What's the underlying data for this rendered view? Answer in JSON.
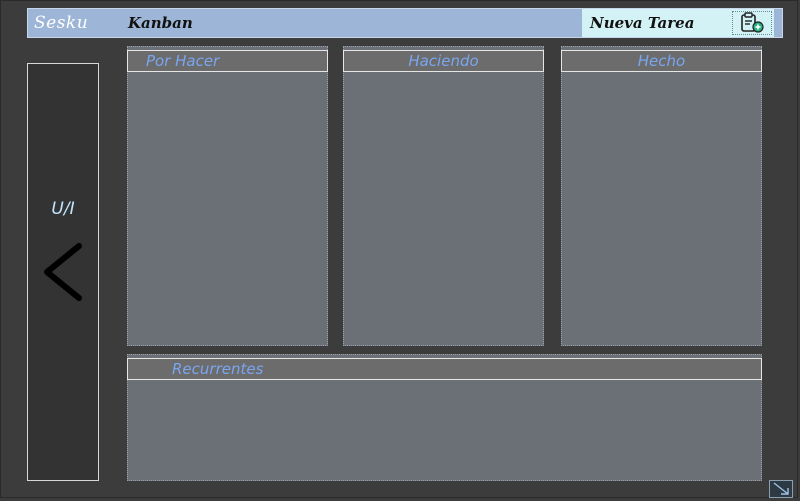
{
  "header": {
    "app_title": "Sesku",
    "view_title": "Kanban",
    "new_task_label": "Nueva Tarea",
    "new_task_icon": "clipboard-add-icon"
  },
  "side_panel": {
    "label": "U/I",
    "collapse_icon": "chevron-left-icon"
  },
  "columns": [
    {
      "label": "Por Hacer"
    },
    {
      "label": "Haciendo"
    },
    {
      "label": "Hecho"
    }
  ],
  "recurrent": {
    "label": "Recurrentes"
  },
  "colors": {
    "header_bg": "#9db5d6",
    "new_task_bg": "#d2f2f6",
    "column_bg": "#6b6f76",
    "column_header_text": "#7aa6f0",
    "panel_bg": "#333333",
    "page_bg": "#3c3c3c"
  }
}
